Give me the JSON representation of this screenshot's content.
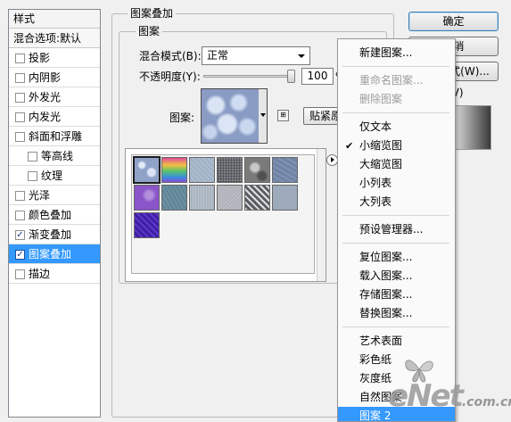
{
  "styles_panel": {
    "header": "样式",
    "default_item": "混合选项:默认",
    "items": [
      {
        "label": "投影",
        "checked": false,
        "sub": false
      },
      {
        "label": "内阴影",
        "checked": false,
        "sub": false
      },
      {
        "label": "外发光",
        "checked": false,
        "sub": false
      },
      {
        "label": "内发光",
        "checked": false,
        "sub": false
      },
      {
        "label": "斜面和浮雕",
        "checked": false,
        "sub": false
      },
      {
        "label": "等高线",
        "checked": false,
        "sub": true
      },
      {
        "label": "纹理",
        "checked": false,
        "sub": true
      },
      {
        "label": "光泽",
        "checked": false,
        "sub": false
      },
      {
        "label": "颜色叠加",
        "checked": false,
        "sub": false
      },
      {
        "label": "渐变叠加",
        "checked": true,
        "sub": false
      },
      {
        "label": "图案叠加",
        "checked": true,
        "sub": false,
        "selected": true
      },
      {
        "label": "描边",
        "checked": false,
        "sub": false
      }
    ]
  },
  "main": {
    "outer_title": "图案叠加",
    "inner_title": "图案",
    "blend_mode_label": "混合模式(B):",
    "blend_mode_value": "正常",
    "opacity_label": "不透明度(Y):",
    "opacity_value": "100",
    "opacity_unit": "%",
    "opacity_level": 1.0,
    "pattern_label": "图案:",
    "snap_button": "贴紧原点"
  },
  "pattern_picker": {
    "swatch_icons": [
      "blue-bubbles-pattern",
      "rainbow-gradient-pattern",
      "blue-gray-texture-pattern",
      "dark-mesh-pattern",
      "gray-stone-pattern",
      "slate-blue-pattern",
      "purple-noise-pattern",
      "teal-gray-pattern",
      "light-gray-texture-pattern",
      "silver-grain-pattern",
      "diagonal-stripe-pattern",
      "blue-gray-noise-pattern",
      "deep-blue-purple-pattern"
    ],
    "swatch_colors": [
      "#8fa3c9",
      "#c25fa8",
      "#9fb1c6",
      "#7c8086",
      "#7a7a7a",
      "#6e83a5",
      "#8a55c9",
      "#5e8597",
      "#a9b4c0",
      "#b9bcc2",
      "#83878d",
      "#98a6b8",
      "#3f1fa0"
    ]
  },
  "dialog_buttons": {
    "ok": "确定",
    "cancel": "取消",
    "new_style": "新建样式(W)...",
    "preview": "预览(V)"
  },
  "menu": {
    "sections": [
      [
        {
          "label": "新建图案..."
        }
      ],
      [
        {
          "label": "重命名图案...",
          "disabled": true
        },
        {
          "label": "删除图案",
          "disabled": true
        }
      ],
      [
        {
          "label": "仅文本"
        },
        {
          "label": "小缩览图",
          "checked": true
        },
        {
          "label": "大缩览图"
        },
        {
          "label": "小列表"
        },
        {
          "label": "大列表"
        }
      ],
      [
        {
          "label": "预设管理器..."
        }
      ],
      [
        {
          "label": "复位图案..."
        },
        {
          "label": "载入图案..."
        },
        {
          "label": "存储图案..."
        },
        {
          "label": "替换图案..."
        }
      ],
      [
        {
          "label": "艺术表面"
        },
        {
          "label": "彩色纸"
        },
        {
          "label": "灰度纸"
        },
        {
          "label": "自然图案"
        },
        {
          "label": "图案 2",
          "highlight": true
        }
      ]
    ],
    "checkmark": "✔"
  },
  "watermark": {
    "big": "eNet",
    "small": ".com.cn"
  },
  "colors": {
    "selection_blue": "#3399ff",
    "dialog_bg": "#f0f0f0"
  }
}
